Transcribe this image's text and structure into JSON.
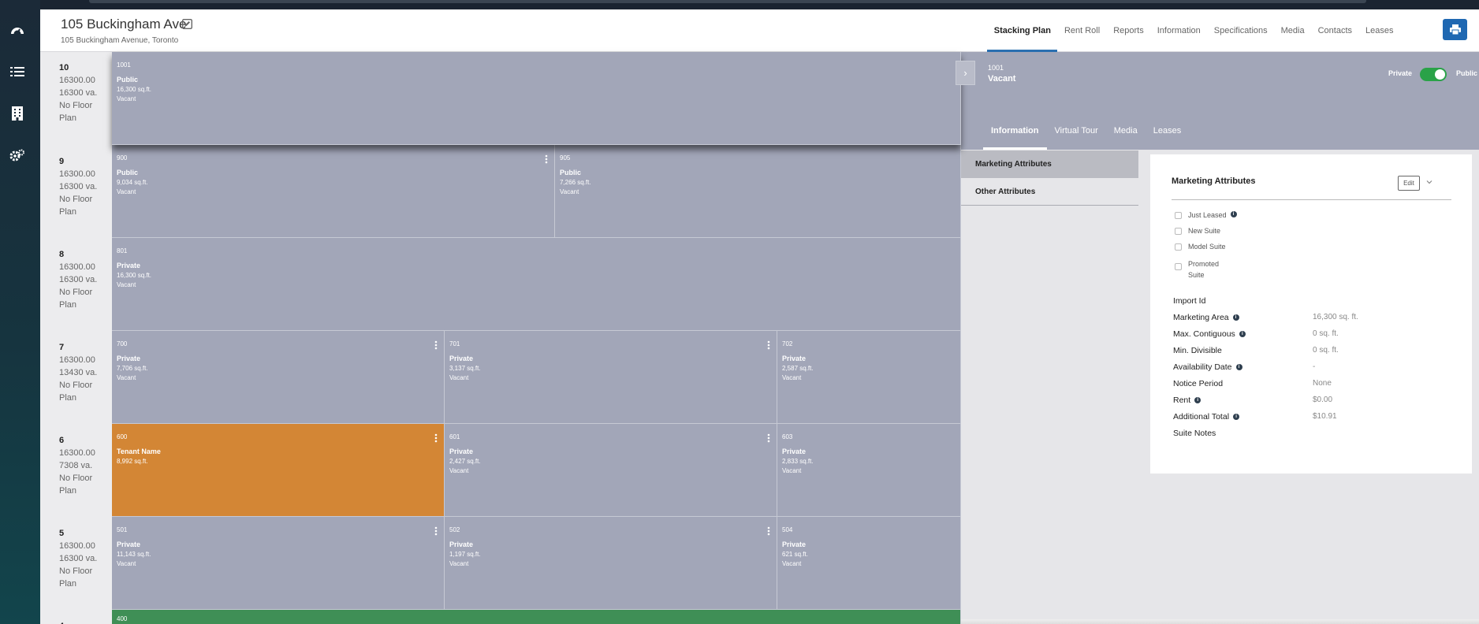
{
  "app": {
    "nav_icons": [
      "dashboard-icon",
      "list-icon",
      "building-icon",
      "settings-icon"
    ]
  },
  "header": {
    "title": "105 Buckingham Ave",
    "subtitle": "105 Buckingham Avenue, Toronto",
    "tabs": [
      {
        "label": "Stacking Plan",
        "active": true
      },
      {
        "label": "Rent Roll"
      },
      {
        "label": "Reports"
      },
      {
        "label": "Information"
      },
      {
        "label": "Specifications"
      },
      {
        "label": "Media"
      },
      {
        "label": "Contacts"
      },
      {
        "label": "Leases"
      }
    ]
  },
  "floors": [
    {
      "num": "10",
      "area": "16300.00",
      "va": "16300 va.",
      "plan": "No Floor Plan"
    },
    {
      "num": "9",
      "area": "16300.00",
      "va": "16300 va.",
      "plan": "No Floor Plan"
    },
    {
      "num": "8",
      "area": "16300.00",
      "va": "16300 va.",
      "plan": "No Floor Plan"
    },
    {
      "num": "7",
      "area": "16300.00",
      "va": "13430 va.",
      "plan": "No Floor Plan"
    },
    {
      "num": "6",
      "area": "16300.00",
      "va": "7308 va.",
      "plan": "No Floor Plan"
    },
    {
      "num": "5",
      "area": "16300.00",
      "va": "16300 va.",
      "plan": "No Floor Plan"
    },
    {
      "num": "4",
      "area": "",
      "va": "",
      "plan": ""
    }
  ],
  "suites": {
    "s1001": {
      "num": "1001",
      "status": "Public",
      "area": "16,300 sq.ft.",
      "vac": "Vacant"
    },
    "s900": {
      "num": "900",
      "status": "Public",
      "area": "9,034 sq.ft.",
      "vac": "Vacant"
    },
    "s905": {
      "num": "905",
      "status": "Public",
      "area": "7,266 sq.ft.",
      "vac": "Vacant"
    },
    "s801": {
      "num": "801",
      "status": "Private",
      "area": "16,300 sq.ft.",
      "vac": "Vacant"
    },
    "s700": {
      "num": "700",
      "status": "Private",
      "area": "7,706 sq.ft.",
      "vac": "Vacant"
    },
    "s701": {
      "num": "701",
      "status": "Private",
      "area": "3,137 sq.ft.",
      "vac": "Vacant"
    },
    "s702": {
      "num": "702",
      "status": "Private",
      "area": "2,587 sq.ft.",
      "vac": "Vacant"
    },
    "s600": {
      "num": "600",
      "status": "Tenant Name",
      "area": "8,992 sq.ft.",
      "vac": ""
    },
    "s601": {
      "num": "601",
      "status": "Private",
      "area": "2,427 sq.ft.",
      "vac": "Vacant"
    },
    "s603": {
      "num": "603",
      "status": "Private",
      "area": "2,833 sq.ft.",
      "vac": "Vacant"
    },
    "s501": {
      "num": "501",
      "status": "Private",
      "area": "11,143 sq.ft.",
      "vac": "Vacant"
    },
    "s502": {
      "num": "502",
      "status": "Private",
      "area": "1,197 sq.ft.",
      "vac": "Vacant"
    },
    "s504": {
      "num": "504",
      "status": "Private",
      "area": "621 sq.ft.",
      "vac": "Vacant"
    },
    "s400": {
      "num": "400"
    }
  },
  "panel": {
    "suite_num": "1001",
    "suite_status": "Vacant",
    "toggle_private": "Private",
    "toggle_public": "Public",
    "toggle_state": "public",
    "tabs": [
      {
        "label": "Information",
        "active": true
      },
      {
        "label": "Virtual Tour"
      },
      {
        "label": "Media"
      },
      {
        "label": "Leases"
      }
    ],
    "sections": [
      {
        "label": "Marketing Attributes",
        "active": true
      },
      {
        "label": "Other Attributes"
      }
    ],
    "card": {
      "title": "Marketing Attributes",
      "edit_label": "Edit",
      "checkboxes": [
        {
          "label": "Just Leased",
          "info": true
        },
        {
          "label": "New Suite"
        },
        {
          "label": "Model Suite"
        },
        {
          "label": "Promoted Suite"
        }
      ],
      "attributes": [
        {
          "label": "Import Id",
          "value": ""
        },
        {
          "label": "Marketing Area",
          "value": "16,300 sq. ft.",
          "info": true
        },
        {
          "label": "Max. Contiguous",
          "value": "0 sq. ft.",
          "info": true
        },
        {
          "label": "Min. Divisible",
          "value": "0 sq. ft."
        },
        {
          "label": "Availability Date",
          "value": "-",
          "info": true
        },
        {
          "label": "Notice Period",
          "value": "None"
        },
        {
          "label": "Rent",
          "value": "$0.00",
          "info": true
        },
        {
          "label": "Additional Total",
          "value": "$10.91",
          "info": true
        },
        {
          "label": "Suite Notes",
          "value": ""
        }
      ]
    }
  },
  "colors": {
    "accent": "#1f68b2",
    "vacant": "#a2a6b8",
    "tenant": "#d38635",
    "leased_green": "#3f8f56",
    "toggle": "#2aa248"
  }
}
